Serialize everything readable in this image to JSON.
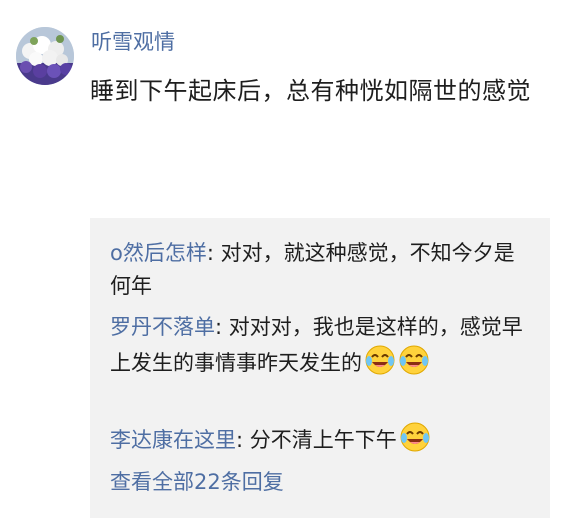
{
  "post": {
    "username": "听雪观情",
    "text": "睡到下午起床后，总有种恍如隔世的感觉"
  },
  "comments": [
    {
      "author": "o然后怎样",
      "separator": ": ",
      "text": "对对，就这种感觉，不知今夕是何年"
    },
    {
      "author": "罗丹不落单",
      "separator": ": ",
      "text": "对对对，我也是这样的，感觉早上发生的事情事昨天发生的",
      "emojis": [
        "laugh-cry-icon",
        "laugh-cry-icon"
      ]
    },
    {
      "author": "李达康在这里",
      "separator": ": ",
      "text": "分不清上午下午",
      "emojis": [
        "laugh-cry-icon"
      ]
    }
  ],
  "view_all": "查看全部22条回复",
  "colors": {
    "link": "#4e6ea3",
    "text": "#1e1e1e",
    "comment_bg": "#f2f2f2"
  }
}
